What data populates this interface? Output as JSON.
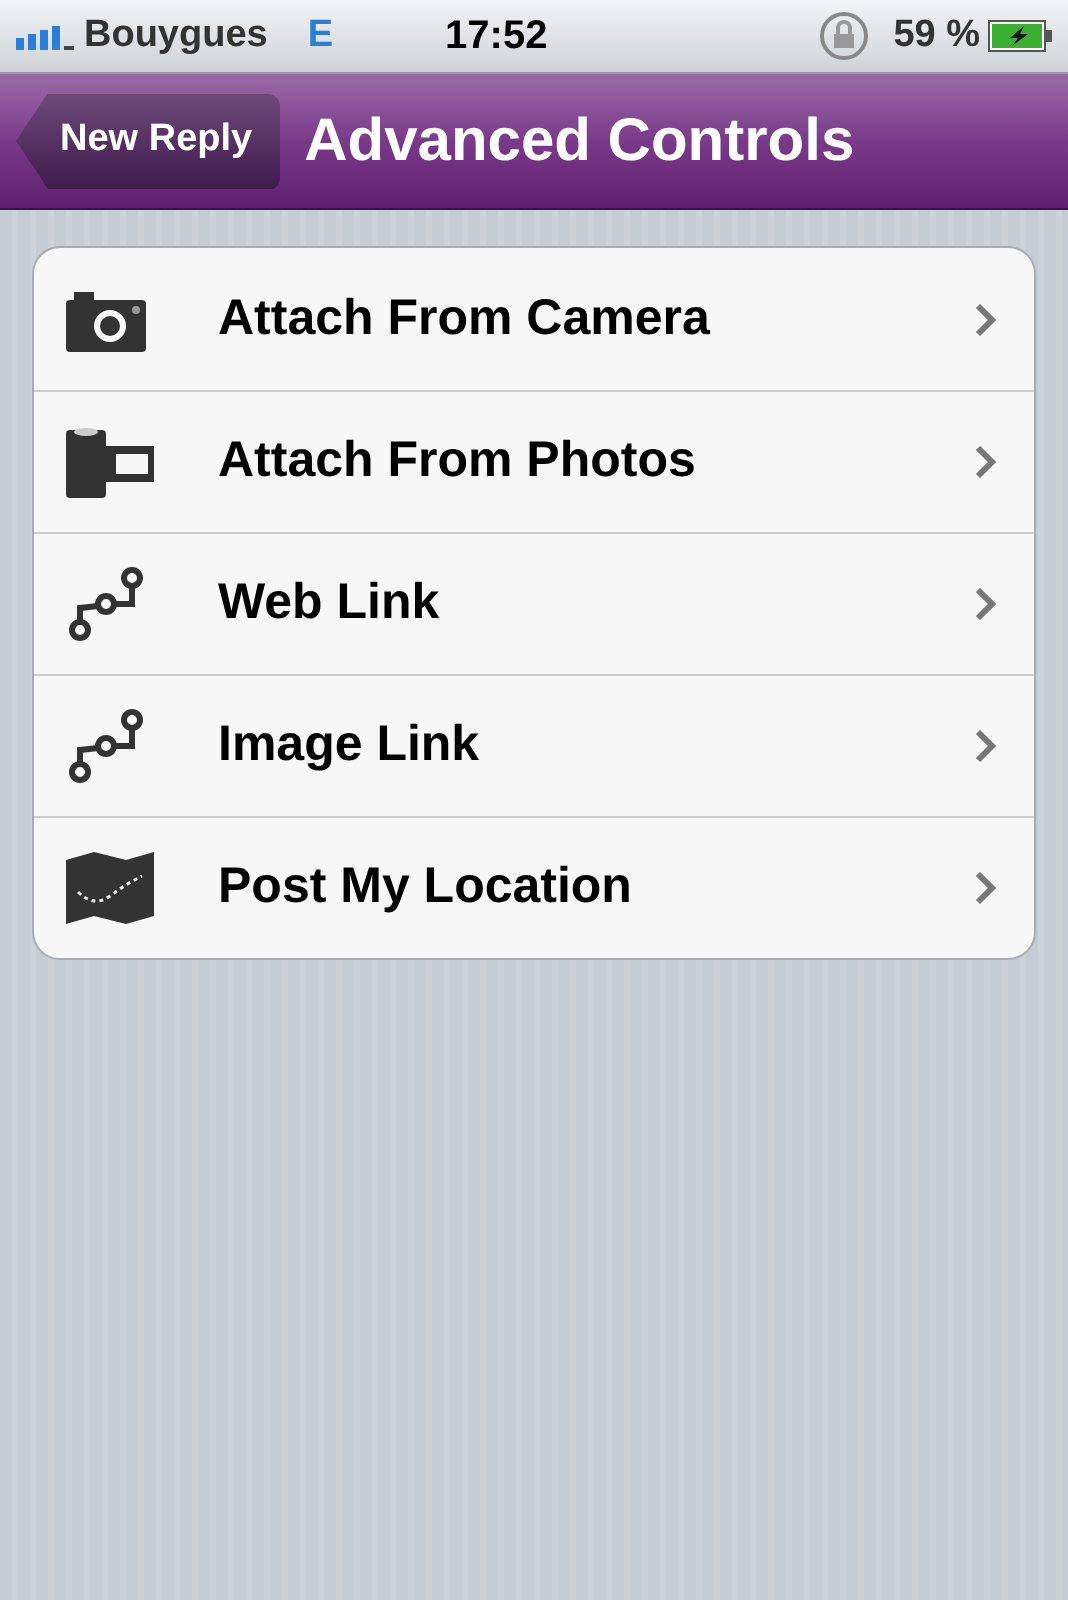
{
  "status_bar": {
    "carrier": "Bouygues",
    "network": "E",
    "time": "17:52",
    "battery": "59 %"
  },
  "nav": {
    "back": "New Reply",
    "title": "Advanced Controls"
  },
  "items": [
    {
      "kind": "camera",
      "label": "Attach From Camera"
    },
    {
      "kind": "film",
      "label": "Attach From Photos"
    },
    {
      "kind": "link",
      "label": "Web Link"
    },
    {
      "kind": "link",
      "label": "Image Link"
    },
    {
      "kind": "map",
      "label": "Post My Location"
    }
  ]
}
